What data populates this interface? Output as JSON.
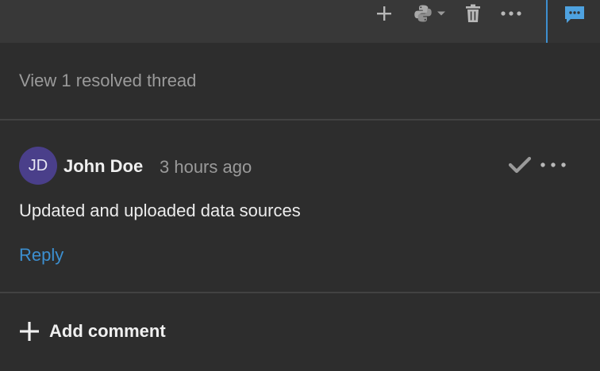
{
  "toolbar": {
    "icons": [
      "plus-icon",
      "python-icon",
      "chevron-down-icon",
      "trash-icon",
      "more-icon",
      "comments-icon"
    ]
  },
  "thread": {
    "resolved_link": "View 1 resolved thread",
    "comment": {
      "avatar_initials": "JD",
      "author": "John Doe",
      "timestamp": "3 hours ago",
      "body": "Updated and uploaded data sources",
      "reply_label": "Reply"
    },
    "add_comment_label": "Add comment"
  },
  "colors": {
    "accent_blue": "#3c8fd0",
    "avatar_bg": "#4a3f8a",
    "panel_bg": "#2d2d2d",
    "toolbar_bg": "#383838"
  }
}
